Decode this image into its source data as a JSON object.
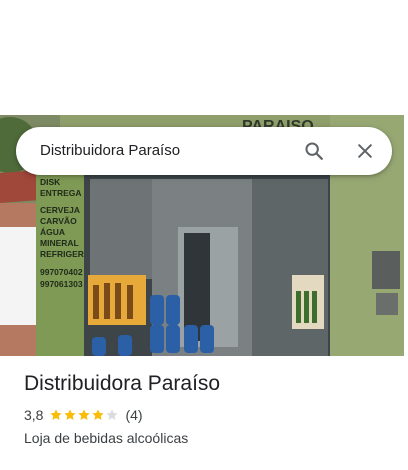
{
  "search": {
    "query": "Distribuidora Paraíso",
    "search_icon": "search-icon",
    "close_icon": "close-icon"
  },
  "photo": {
    "sign_top": "PARAISO",
    "store_sign_lines": [
      "DISK",
      "ENTREGA",
      "CERVEJA",
      "CARVÃO",
      "ÁGUA",
      "MINERAL",
      "REFRIGERANT",
      "997070402",
      "997061303"
    ]
  },
  "place": {
    "name": "Distribuidora Paraíso",
    "rating": "3,8",
    "rating_value": 3.8,
    "rating_max": 5,
    "review_count": "(4)",
    "category": "Loja de bebidas alcoólicas"
  },
  "colors": {
    "star_filled": "#fbbc04",
    "star_empty": "#dadce0",
    "text_primary": "#202124",
    "text_secondary": "#3c4043"
  }
}
